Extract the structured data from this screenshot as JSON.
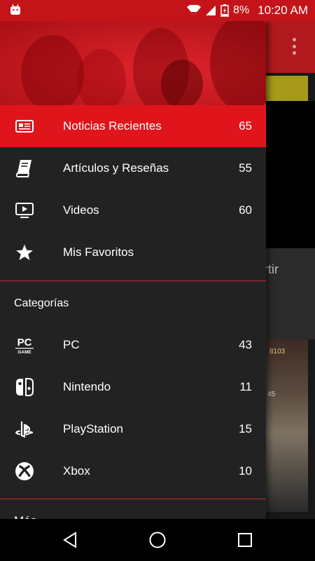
{
  "status_bar": {
    "battery_percent": "8%",
    "time": "10:20 AM",
    "icons": [
      "android-debug-icon",
      "wifi-icon",
      "cell-signal-icon",
      "battery-icon"
    ]
  },
  "background": {
    "partial_text": "artir",
    "image_numbers": [
      "8103",
      "45"
    ]
  },
  "drawer": {
    "main_items": [
      {
        "label": "Noticias Recientes",
        "count": "65",
        "icon": "newspaper-icon",
        "active": true
      },
      {
        "label": "Artículos y Reseñas",
        "count": "55",
        "icon": "book-icon",
        "active": false
      },
      {
        "label": "Videos",
        "count": "60",
        "icon": "video-icon",
        "active": false
      },
      {
        "label": "Mis Favoritos",
        "count": "",
        "icon": "star-icon",
        "active": false
      }
    ],
    "categories_title": "Categorías",
    "category_items": [
      {
        "label": "PC",
        "count": "43",
        "icon": "pc-game-icon"
      },
      {
        "label": "Nintendo",
        "count": "11",
        "icon": "nintendo-switch-icon"
      },
      {
        "label": "PlayStation",
        "count": "15",
        "icon": "playstation-icon"
      },
      {
        "label": "Xbox",
        "count": "10",
        "icon": "xbox-icon"
      }
    ],
    "next_section_cut": "Más"
  },
  "colors": {
    "accent": "#e0151b",
    "status_bar": "#c4141a",
    "drawer_bg": "#222222",
    "divider": "#c9262b"
  },
  "nav_bar": {
    "buttons": [
      "back-icon",
      "home-icon",
      "recents-icon"
    ]
  }
}
